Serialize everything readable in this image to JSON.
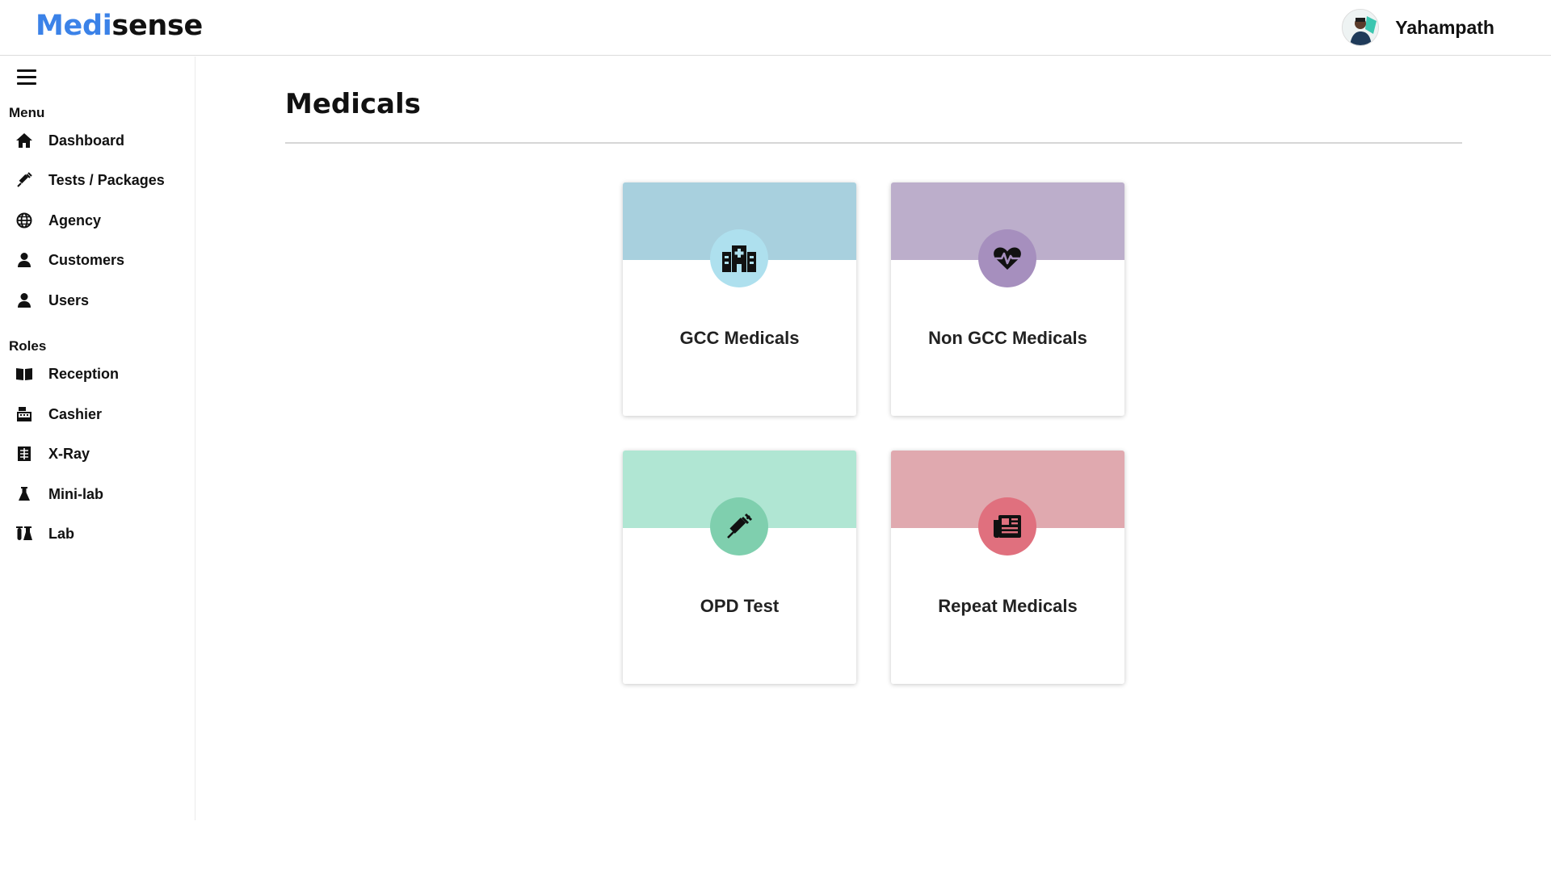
{
  "header": {
    "logo_part1": "Medi",
    "logo_part2": "sense",
    "username": "Yahampath",
    "brand_color": "#3b82e8"
  },
  "sidebar": {
    "menu_label": "Menu",
    "menu_items": [
      {
        "label": "Dashboard",
        "icon": "home-icon"
      },
      {
        "label": "Tests / Packages",
        "icon": "syringe-icon"
      },
      {
        "label": "Agency",
        "icon": "globe-icon"
      },
      {
        "label": "Customers",
        "icon": "user-icon"
      },
      {
        "label": "Users",
        "icon": "user-icon"
      }
    ],
    "roles_label": "Roles",
    "role_items": [
      {
        "label": "Reception",
        "icon": "book-open-icon"
      },
      {
        "label": "Cashier",
        "icon": "cash-register-icon"
      },
      {
        "label": "X-Ray",
        "icon": "x-ray-icon"
      },
      {
        "label": "Mini-lab",
        "icon": "flask-icon"
      },
      {
        "label": "Lab",
        "icon": "vials-icon"
      }
    ]
  },
  "main": {
    "title": "Medicals",
    "cards": [
      {
        "label": "GCC Medicals",
        "icon": "hospital-icon",
        "top_color": "#a8d0de",
        "circle_color": "#aee0ee"
      },
      {
        "label": "Non GCC Medicals",
        "icon": "heart-pulse-icon",
        "top_color": "#bcaecb",
        "circle_color": "#a68fbe"
      },
      {
        "label": "OPD Test",
        "icon": "syringe-icon",
        "top_color": "#b0e6d3",
        "circle_color": "#7fcfae"
      },
      {
        "label": "Repeat Medicals",
        "icon": "newspaper-icon",
        "top_color": "#e0a9af",
        "circle_color": "#e0707e"
      }
    ]
  }
}
